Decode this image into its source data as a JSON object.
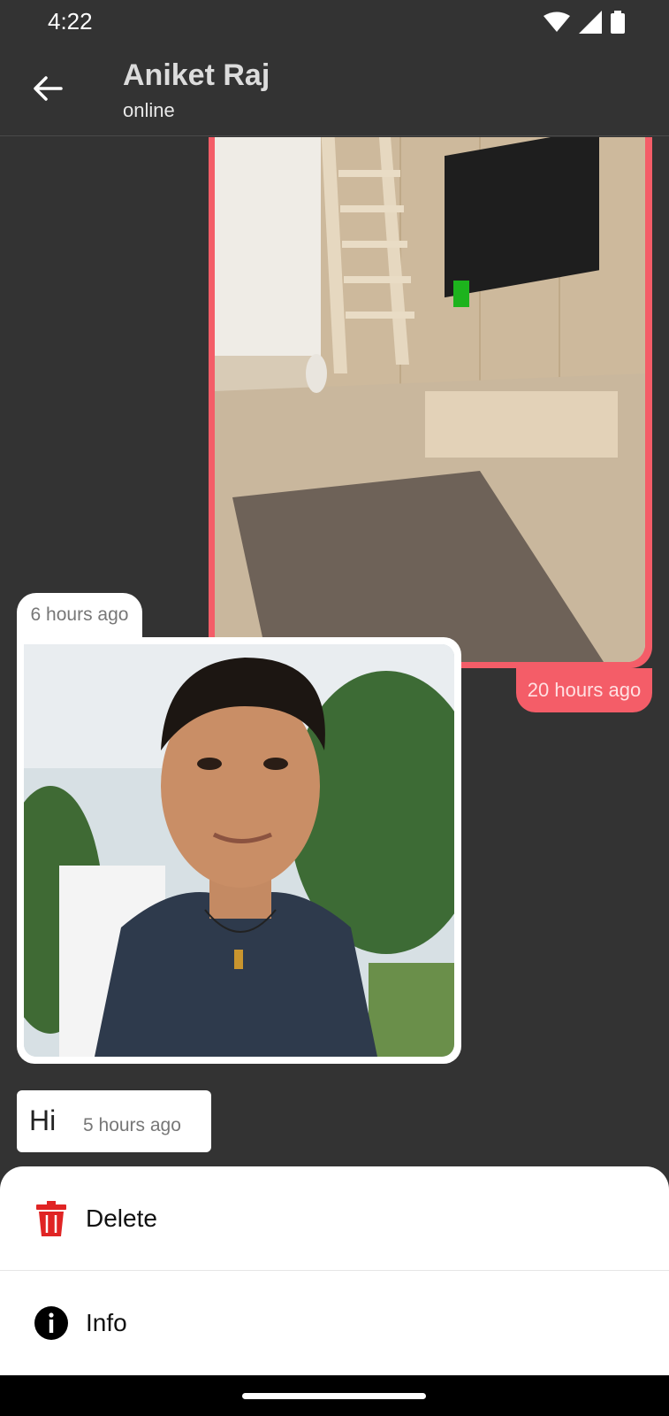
{
  "status_bar": {
    "time": "4:22",
    "icons": [
      "wifi-icon",
      "signal-icon",
      "battery-icon"
    ]
  },
  "header": {
    "contact_name": "Aniket Raj",
    "contact_status": "online"
  },
  "messages": [
    {
      "direction": "outgoing",
      "type": "image",
      "image": "living-room-tv-photo",
      "time": "20 hours ago"
    },
    {
      "direction": "incoming",
      "type": "image",
      "image": "young-man-portrait-photo",
      "time": "6 hours ago"
    },
    {
      "direction": "incoming",
      "type": "text",
      "text": "Hi",
      "time": "5 hours ago"
    }
  ],
  "sheet": {
    "items": [
      {
        "label": "Delete",
        "icon": "trash-icon"
      },
      {
        "label": "Info",
        "icon": "info-icon"
      }
    ]
  },
  "colors": {
    "background": "#333333",
    "outgoing_bubble": "#f45d68",
    "incoming_bubble": "#ffffff",
    "delete_icon": "#e02424"
  }
}
